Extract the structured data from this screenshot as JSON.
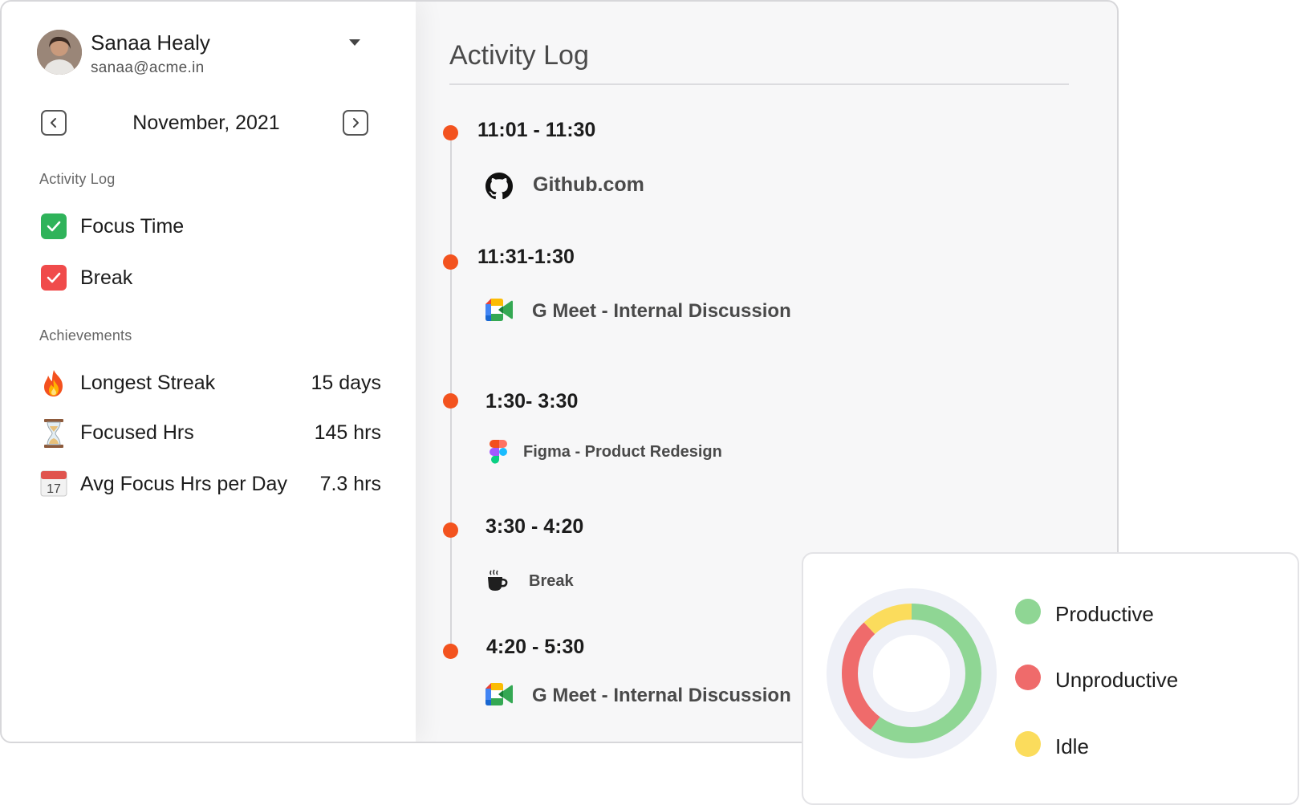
{
  "user": {
    "name": "Sanaa Healy",
    "email": "sanaa@acme.in"
  },
  "calendar": {
    "month": "November, 2021"
  },
  "sidebar": {
    "activity_log_title": "Activity Log",
    "filters": [
      {
        "label": "Focus Time",
        "checked": true,
        "color": "#2fb35a"
      },
      {
        "label": "Break",
        "checked": true,
        "color": "#f04b4b"
      }
    ],
    "achievements_title": "Achievements",
    "achievements": [
      {
        "icon": "fire-icon",
        "label": "Longest Streak",
        "value": "15 days"
      },
      {
        "icon": "hourglass-icon",
        "label": "Focused Hrs",
        "value": "145 hrs"
      },
      {
        "icon": "calendar-icon",
        "label": "Avg Focus Hrs per Day",
        "value": "7.3 hrs"
      }
    ]
  },
  "main": {
    "title": "Activity Log",
    "entries": [
      {
        "time": "11:01 - 11:30",
        "app": "Github.com",
        "icon": "github-icon"
      },
      {
        "time": "11:31-1:30",
        "app": "G Meet - Internal Discussion",
        "icon": "google-meet-icon"
      },
      {
        "time": "1:30- 3:30",
        "app": "Figma - Product Redesign",
        "icon": "figma-icon"
      },
      {
        "time": "3:30 - 4:20",
        "app": "Break",
        "icon": "coffee-cup-icon"
      },
      {
        "time": "4:20 - 5:30",
        "app": "G Meet - Internal Discussion",
        "icon": "google-meet-icon"
      }
    ],
    "accent_color": "#f3531f"
  },
  "chart_data": {
    "type": "pie",
    "categories": [
      "Productive",
      "Unproductive",
      "Idle"
    ],
    "values": [
      60,
      28,
      12
    ],
    "colors": [
      "#8fd694",
      "#ef6b6b",
      "#fbdc5c"
    ],
    "legend": "right"
  }
}
